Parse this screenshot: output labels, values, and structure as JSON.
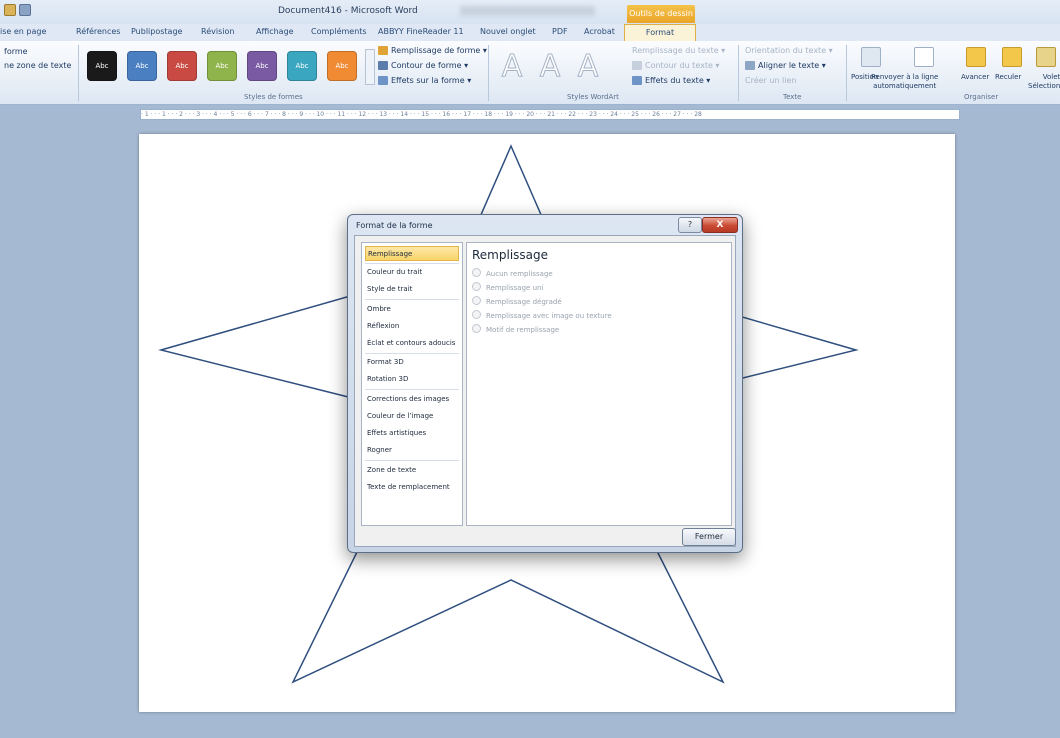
{
  "titlebar": {
    "document_title": "Document416 - Microsoft Word",
    "context_tab_group": "Outils de dessin"
  },
  "tabs": [
    {
      "label": "ise en page"
    },
    {
      "label": "Références"
    },
    {
      "label": "Publipostage"
    },
    {
      "label": "Révision"
    },
    {
      "label": "Affichage"
    },
    {
      "label": "Compléments"
    },
    {
      "label": "ABBYY FineReader 11"
    },
    {
      "label": "Nouvel onglet"
    },
    {
      "label": "PDF"
    },
    {
      "label": "Acrobat"
    }
  ],
  "active_tab": "Format",
  "ribbon": {
    "insert_group": {
      "line1": "forme",
      "line2": "ne zone de texte"
    },
    "shape_styles": {
      "swatch_label": "Abc",
      "swatches": [
        {
          "color": "#1a1a1a"
        },
        {
          "color": "#4a7fc1"
        },
        {
          "color": "#c94a43"
        },
        {
          "color": "#8fb44b"
        },
        {
          "color": "#7a5ba3"
        },
        {
          "color": "#3aa6c0"
        },
        {
          "color": "#f08b34"
        }
      ],
      "fill_label": "Remplissage de forme",
      "outline_label": "Contour de forme",
      "effects_label": "Effets sur la forme",
      "group_label": "Styles de formes"
    },
    "wordart": {
      "letter": "A",
      "text_fill_label": "Remplissage du texte",
      "text_outline_label": "Contour du texte",
      "text_effects_label": "Effets du texte",
      "group_label": "Styles WordArt"
    },
    "text_group": {
      "direction_label": "Orientation du texte",
      "align_label": "Aligner le texte",
      "link_label": "Créer un lien",
      "group_label": "Texte"
    },
    "arrange": {
      "position_label": "Position",
      "wrap_label_1": "Renvoyer à la ligne",
      "wrap_label_2": "automatiquement",
      "forward_label": "Avancer",
      "backward_label": "Reculer",
      "pane_label_1": "Volet",
      "pane_label_2": "Sélection",
      "group_label": "Organiser"
    }
  },
  "ruler": {
    "marks": "· 1 · · · 1 · · · 2 · · · 3 · · · 4 · · · 5 · · · 6 · · · 7 · · · 8 · · · 9 · · · 10 · · · 11 · · · 12 · · · 13 · · · 14 · · · 15 · · · 16 · · · 17 · · · 18 · · · 19 · · · 20 · · · 21 · · · 22 · · · 23 · · · 24 · · · 25 · · · 26 · · · 27 · · · 28"
  },
  "star": {
    "stroke_color": "#2f4f7f"
  },
  "dialog": {
    "title": "Format de la forme",
    "help": "?",
    "close": "X",
    "nav": [
      {
        "label": "Remplissage",
        "selected": true
      },
      {
        "label": "Couleur du trait"
      },
      {
        "label": "Style de trait"
      },
      {
        "label": "Ombre"
      },
      {
        "label": "Réflexion"
      },
      {
        "label": "Éclat et contours adoucis"
      },
      {
        "label": "Format 3D"
      },
      {
        "label": "Rotation 3D"
      },
      {
        "label": "Corrections des images"
      },
      {
        "label": "Couleur de l’image"
      },
      {
        "label": "Effets artistiques"
      },
      {
        "label": "Rogner"
      },
      {
        "label": "Zone de texte"
      },
      {
        "label": "Texte de remplacement"
      }
    ],
    "content_title": "Remplissage",
    "options": [
      {
        "label": "Aucun remplissage"
      },
      {
        "label": "Remplissage uni"
      },
      {
        "label": "Remplissage dégradé"
      },
      {
        "label": "Remplissage avec image ou texture"
      },
      {
        "label": "Motif de remplissage"
      }
    ],
    "close_button": "Fermer"
  }
}
